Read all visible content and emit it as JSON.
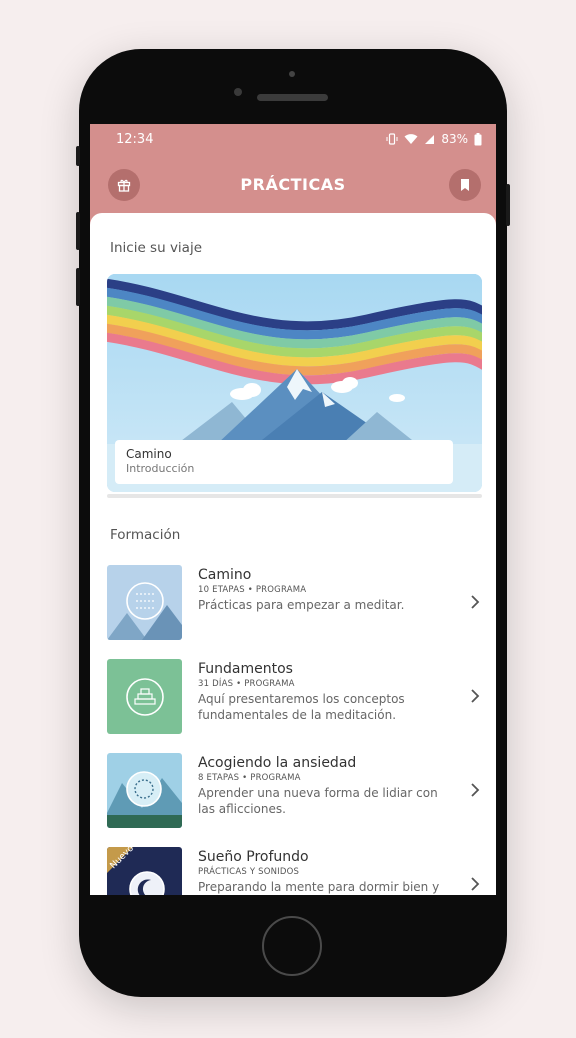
{
  "status": {
    "time": "12:34",
    "battery": "83%"
  },
  "header": {
    "title": "PRÁCTICAS",
    "left_icon": "gift-icon",
    "right_icon": "bookmark-icon"
  },
  "journey": {
    "section_title": "Inicie su viaje",
    "card": {
      "title": "Camino",
      "subtitle": "Introducción"
    }
  },
  "formacion": {
    "section_title": "Formación",
    "items": [
      {
        "title": "Camino",
        "meta": "10 ETAPAS • PROGRAMA",
        "desc": "Prácticas para empezar a meditar."
      },
      {
        "title": "Fundamentos",
        "meta": "31 DÍAS • PROGRAMA",
        "desc": "Aquí presentaremos los conceptos fundamentales de la meditación."
      },
      {
        "title": "Acogiendo la ansiedad",
        "meta": "8 ETAPAS • PROGRAMA",
        "desc": "Aprender una nueva forma de lidiar con las aflicciones."
      },
      {
        "title": "Sueño Profundo",
        "meta": "PRÁCTICAS Y SONIDOS",
        "desc": "Preparando la mente para dormir bien y",
        "badge": "Nuevo"
      }
    ]
  },
  "colors": {
    "header": "#d48f8d",
    "header_button": "#b46f6d",
    "background": "#f6eeee"
  }
}
